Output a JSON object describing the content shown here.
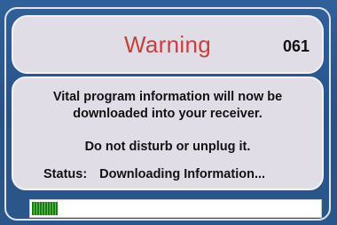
{
  "dialog": {
    "title": "Warning",
    "code": "061",
    "message_line1": "Vital program information will now be",
    "message_line2": "downloaded into your receiver.",
    "instruction": "Do not disturb or unplug it.",
    "status_label": "Status:",
    "status_value": "Downloading Information..."
  },
  "progress": {
    "fraction": 0.09
  },
  "colors": {
    "background": "#2a5487",
    "panel": "#e1dde7",
    "title": "#c8403a",
    "progress_fill": "#3ea33a"
  }
}
